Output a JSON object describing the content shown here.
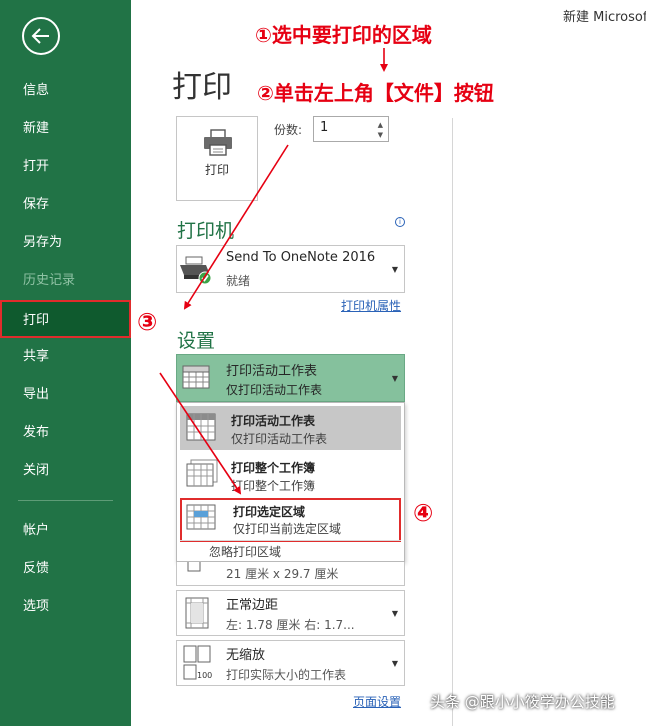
{
  "window": {
    "title": "新建 Microsoft"
  },
  "sidebar": {
    "items": [
      {
        "label": "信息"
      },
      {
        "label": "新建"
      },
      {
        "label": "打开"
      },
      {
        "label": "保存"
      },
      {
        "label": "另存为"
      },
      {
        "label": "历史记录",
        "disabled": true
      },
      {
        "label": "打印",
        "active": true
      },
      {
        "label": "共享"
      },
      {
        "label": "导出"
      },
      {
        "label": "发布"
      },
      {
        "label": "关闭"
      },
      {
        "label": "帐户"
      },
      {
        "label": "反馈"
      },
      {
        "label": "选项"
      }
    ]
  },
  "main": {
    "title": "打印",
    "print_button_label": "打印",
    "copies": {
      "label": "份数:",
      "value": "1"
    },
    "printer": {
      "section_title": "打印机",
      "name": "Send To OneNote 2016",
      "status": "就绪",
      "properties_link": "打印机属性"
    },
    "settings": {
      "section_title": "设置",
      "selected": {
        "title": "打印活动工作表",
        "subtitle": "仅打印活动工作表"
      },
      "options": [
        {
          "title": "打印活动工作表",
          "subtitle": "仅打印活动工作表"
        },
        {
          "title": "打印整个工作簿",
          "subtitle": "打印整个工作簿"
        },
        {
          "title": "打印选定区域",
          "subtitle": "仅打印当前选定区域"
        }
      ],
      "ignore_print_area": "忽略打印区域",
      "paper_size": "21 厘米 x 29.7 厘米",
      "margins": {
        "title": "正常边距",
        "subtitle": "左: 1.78 厘米    右: 1.7..."
      },
      "scaling": {
        "title": "无缩放",
        "subtitle": "打印实际大小的工作表"
      },
      "page_setup_link": "页面设置"
    }
  },
  "annotations": {
    "step1": "①选中要打印的区域",
    "step2": "②单击左上角【文件】按钮",
    "step3": "③",
    "step4": "④",
    "color": "#e60012"
  },
  "watermark": "头条 @跟小小筱学办公技能",
  "colors": {
    "sidebar": "#217346",
    "accent": "#217346",
    "link": "#2a62b7",
    "highlight": "#e02c2c"
  }
}
